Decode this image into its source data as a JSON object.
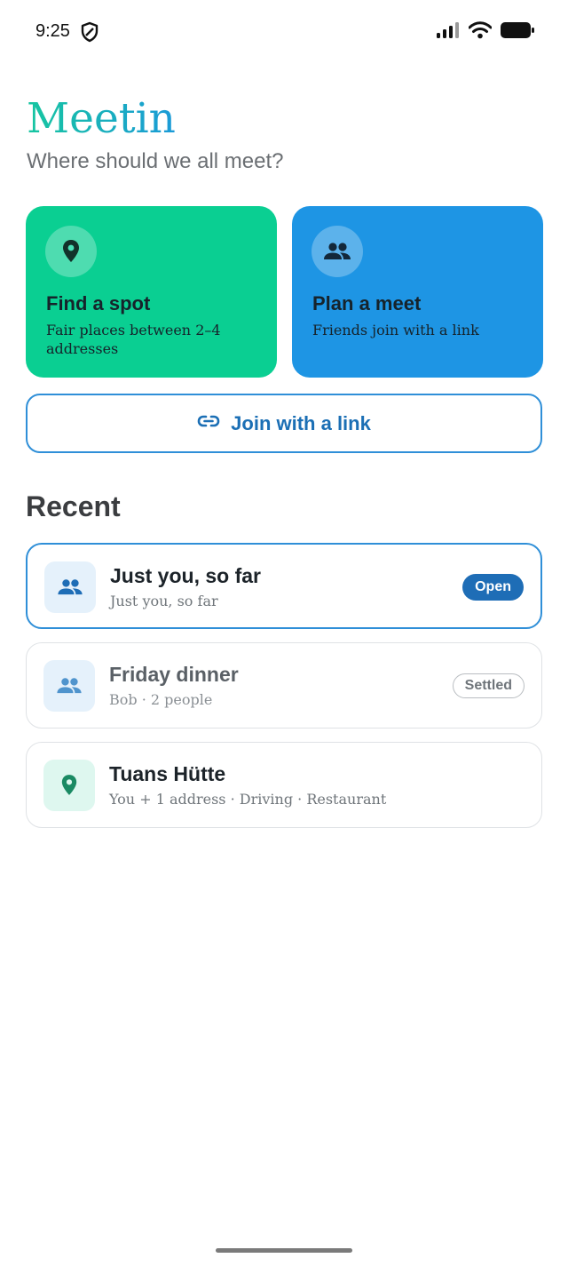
{
  "status_bar": {
    "time": "9:25"
  },
  "header": {
    "title": "Meetin",
    "subtitle": "Where should we all meet?"
  },
  "tiles": [
    {
      "title": "Find a spot",
      "subtitle": "Fair places between 2–4 addresses",
      "icon": "location-pin-icon",
      "color": "#0acf92"
    },
    {
      "title": "Plan a meet",
      "subtitle": "Friends join with a link",
      "icon": "people-icon",
      "color": "#1e95e4"
    }
  ],
  "join": {
    "label": "Join with a link",
    "icon": "link-icon"
  },
  "recent": {
    "heading": "Recent",
    "items": [
      {
        "title": "Just you, so far",
        "subtitle": "Just you, so far",
        "badge": "Open",
        "icon": "people-icon"
      },
      {
        "title": "Friday dinner",
        "subtitle": "Bob · 2 people",
        "badge": "Settled",
        "icon": "people-icon"
      },
      {
        "title": "Tuans Hütte",
        "subtitle": "You + 1 address · Driving · Restaurant",
        "icon": "location-pin-icon"
      }
    ]
  },
  "colors": {
    "accent": "#1e6db6",
    "green": "#0acf92",
    "blue": "#1e95e4"
  }
}
